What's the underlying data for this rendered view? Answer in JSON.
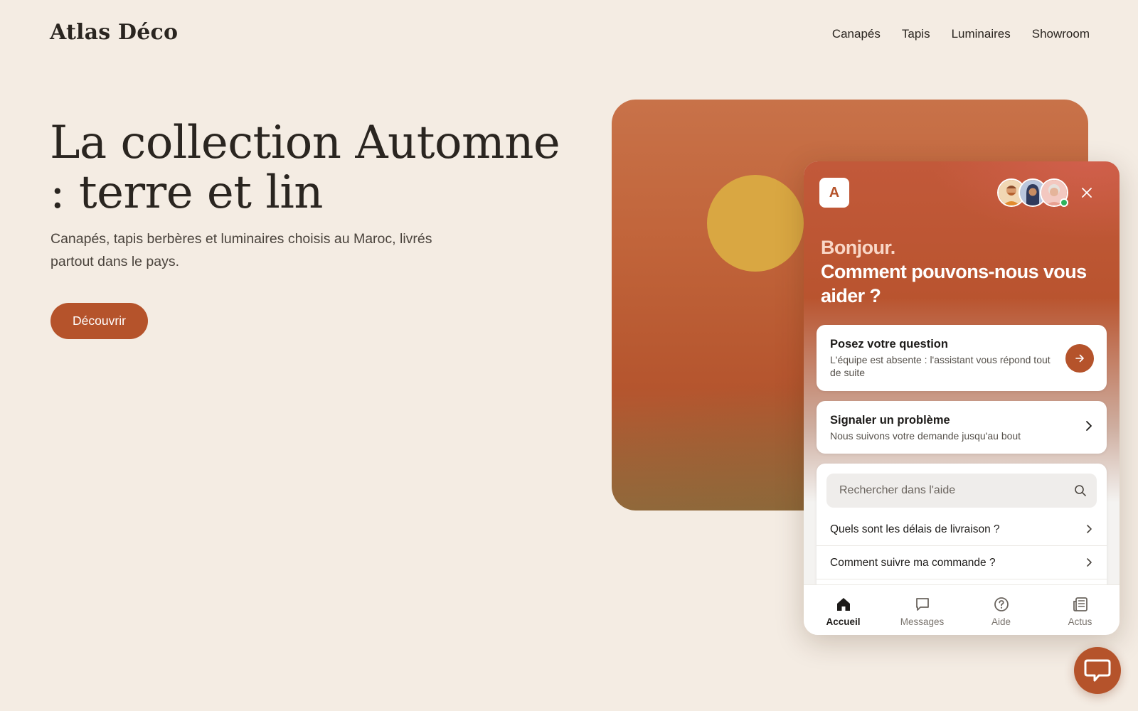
{
  "header": {
    "logo": "Atlas Déco",
    "nav": [
      "Canapés",
      "Tapis",
      "Luminaires",
      "Showroom"
    ]
  },
  "hero": {
    "title": "La collection Automne : terre et lin",
    "subtitle": "Canapés, tapis berbères et luminaires choisis au Maroc, livrés partout dans le pays.",
    "cta_label": "Découvrir"
  },
  "widget": {
    "brand_initial": "A",
    "greeting_hello": "Bonjour.",
    "greeting_question": "Comment pouvons-nous vous aider ?",
    "ask": {
      "title": "Posez votre question",
      "desc": "L'équipe est absente : l'assistant vous répond tout de suite"
    },
    "report": {
      "title": "Signaler un problème",
      "desc": "Nous suivons votre demande jusqu'au bout"
    },
    "search": {
      "placeholder": "Rechercher dans l'aide"
    },
    "faq": [
      "Quels sont les délais de livraison ?",
      "Comment suivre ma commande ?"
    ],
    "tabs": [
      {
        "label": "Accueil",
        "icon": "home-icon",
        "active": true
      },
      {
        "label": "Messages",
        "icon": "message-icon",
        "active": false
      },
      {
        "label": "Aide",
        "icon": "help-icon",
        "active": false
      },
      {
        "label": "Actus",
        "icon": "news-icon",
        "active": false
      }
    ]
  },
  "colors": {
    "accent": "#b5532b",
    "background": "#f4ece3",
    "sun": "#d9a742",
    "online": "#2fb35d"
  }
}
